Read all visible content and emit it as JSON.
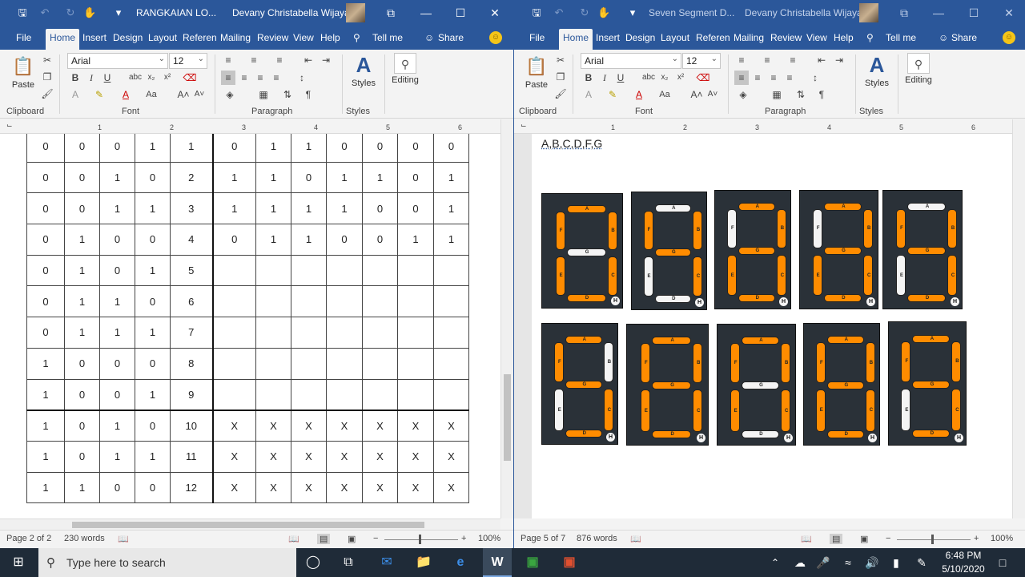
{
  "window_left": {
    "doc_title": "RANGKAIAN LO...",
    "user_name": "Devany Christabella Wijaya",
    "menu": [
      "File",
      "Home",
      "Insert",
      "Design",
      "Layout",
      "Referen",
      "Mailing",
      "Review",
      "View",
      "Help"
    ],
    "tell_me": "Tell me",
    "share": "Share",
    "font_name": "Arial",
    "font_size": "12",
    "paste_label": "Paste",
    "styles_label": "Styles",
    "editing_label": "Editing",
    "groups": [
      "Clipboard",
      "Font",
      "Paragraph",
      "Styles"
    ],
    "table_rows": [
      [
        "0",
        "0",
        "0",
        "1",
        "1",
        "0",
        "1",
        "1",
        "0",
        "0",
        "0",
        "0"
      ],
      [
        "0",
        "0",
        "1",
        "0",
        "2",
        "1",
        "1",
        "0",
        "1",
        "1",
        "0",
        "1"
      ],
      [
        "0",
        "0",
        "1",
        "1",
        "3",
        "1",
        "1",
        "1",
        "1",
        "0",
        "0",
        "1"
      ],
      [
        "0",
        "1",
        "0",
        "0",
        "4",
        "0",
        "1",
        "1",
        "0",
        "0",
        "1",
        "1"
      ],
      [
        "0",
        "1",
        "0",
        "1",
        "5",
        "",
        "",
        "",
        "",
        "",
        "",
        ""
      ],
      [
        "0",
        "1",
        "1",
        "0",
        "6",
        "",
        "",
        "",
        "",
        "",
        "",
        ""
      ],
      [
        "0",
        "1",
        "1",
        "1",
        "7",
        "",
        "",
        "",
        "",
        "",
        "",
        ""
      ],
      [
        "1",
        "0",
        "0",
        "0",
        "8",
        "",
        "",
        "",
        "",
        "",
        "",
        ""
      ],
      [
        "1",
        "0",
        "0",
        "1",
        "9",
        "",
        "",
        "",
        "",
        "",
        "",
        ""
      ],
      [
        "1",
        "0",
        "1",
        "0",
        "10",
        "X",
        "X",
        "X",
        "X",
        "X",
        "X",
        "X"
      ],
      [
        "1",
        "0",
        "1",
        "1",
        "11",
        "X",
        "X",
        "X",
        "X",
        "X",
        "X",
        "X"
      ],
      [
        "1",
        "1",
        "0",
        "0",
        "12",
        "X",
        "X",
        "X",
        "X",
        "X",
        "X",
        "X"
      ]
    ],
    "status_page": "Page 2 of 2",
    "status_words": "230 words",
    "zoom": "100%"
  },
  "window_right": {
    "doc_title": "Seven Segment D...",
    "user_name": "Devany Christabella Wijaya",
    "menu": [
      "File",
      "Home",
      "Insert",
      "Design",
      "Layout",
      "Referen",
      "Mailing",
      "Review",
      "View",
      "Help"
    ],
    "tell_me": "Tell me",
    "share": "Share",
    "font_name": "Arial",
    "font_size": "12",
    "paste_label": "Paste",
    "styles_label": "Styles",
    "editing_label": "Editing",
    "groups": [
      "Clipboard",
      "Font",
      "Paragraph",
      "Styles"
    ],
    "doc_text": "A,B,C,D,F,G",
    "segment_labels": {
      "a": "A",
      "b": "B",
      "c": "C",
      "d": "D",
      "e": "E",
      "f": "F",
      "g": "G",
      "h": "H"
    },
    "displays": [
      {
        "on": [
          "a",
          "b",
          "c",
          "d",
          "e",
          "f"
        ]
      },
      {
        "on": [
          "b",
          "c",
          "f",
          "g"
        ]
      },
      {
        "on": [
          "a",
          "b",
          "c",
          "d",
          "e",
          "g"
        ]
      },
      {
        "on": [
          "a",
          "b",
          "c",
          "d",
          "e",
          "g"
        ]
      },
      {
        "on": [
          "b",
          "c",
          "d",
          "f",
          "g"
        ]
      },
      {
        "on": [
          "a",
          "c",
          "d",
          "f",
          "g"
        ]
      },
      {
        "on": [
          "a",
          "b",
          "c",
          "d",
          "e",
          "f",
          "g"
        ]
      },
      {
        "on": [
          "a",
          "b",
          "c",
          "e",
          "f"
        ]
      },
      {
        "on": [
          "a",
          "b",
          "c",
          "d",
          "e",
          "f",
          "g"
        ]
      },
      {
        "on": [
          "a",
          "b",
          "c",
          "d",
          "f",
          "g"
        ]
      }
    ],
    "status_page": "Page 5 of 7",
    "status_words": "876 words",
    "zoom": "100%"
  },
  "taskbar": {
    "search_placeholder": "Type here to search",
    "time": "6:48 PM",
    "date": "5/10/2020"
  },
  "colors": {
    "word_blue": "#2b579a",
    "segment_on": "#ff8c00",
    "segment_off": "#f4f4f4",
    "display_bg": "#2a3138"
  }
}
